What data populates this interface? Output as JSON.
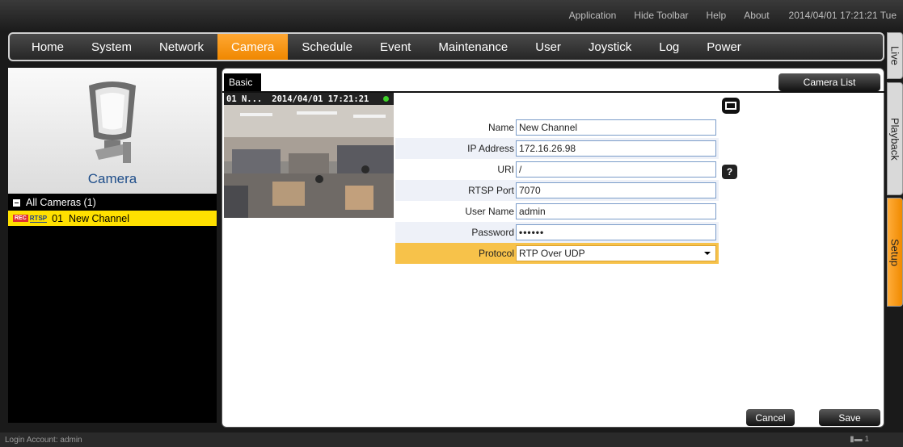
{
  "toolbar": {
    "links": [
      "Application",
      "Hide Toolbar",
      "Help",
      "About"
    ],
    "datetime": "2014/04/01 17:21:21 Tue"
  },
  "menu": {
    "items": [
      "Home",
      "System",
      "Network",
      "Camera",
      "Schedule",
      "Event",
      "Maintenance",
      "User",
      "Joystick",
      "Log",
      "Power"
    ],
    "active": "Camera"
  },
  "side_tabs": {
    "live": "Live",
    "playback": "Playback",
    "setup": "Setup"
  },
  "left": {
    "title": "Camera",
    "tree_root": "All Cameras (1)",
    "channel": {
      "rec_badge": "REC",
      "rtsp_badge": "RTSP",
      "label": "01  New Channel"
    }
  },
  "content": {
    "tab": "Basic",
    "camera_list_button": "Camera List",
    "preview": {
      "name": "01 N...",
      "timestamp": "2014/04/01 17:21:21"
    },
    "form": {
      "name_label": "Name",
      "name_value": "New Channel",
      "ip_label": "IP Address",
      "ip_value": "172.16.26.98",
      "uri_label": "URI",
      "uri_value": "/",
      "rtsp_label": "RTSP Port",
      "rtsp_value": "7070",
      "user_label": "User Name",
      "user_value": "admin",
      "password_label": "Password",
      "password_value": "••••••",
      "protocol_label": "Protocol",
      "protocol_value": "RTP Over UDP"
    },
    "help_button": "?",
    "cancel_button": "Cancel",
    "save_button": "Save"
  },
  "status": {
    "login": "Login Account: admin",
    "right_count": "1"
  },
  "colors": {
    "accent_orange": "#f08800",
    "selected_yellow": "#ffe000",
    "camera_title_blue": "#1f4e8a"
  }
}
